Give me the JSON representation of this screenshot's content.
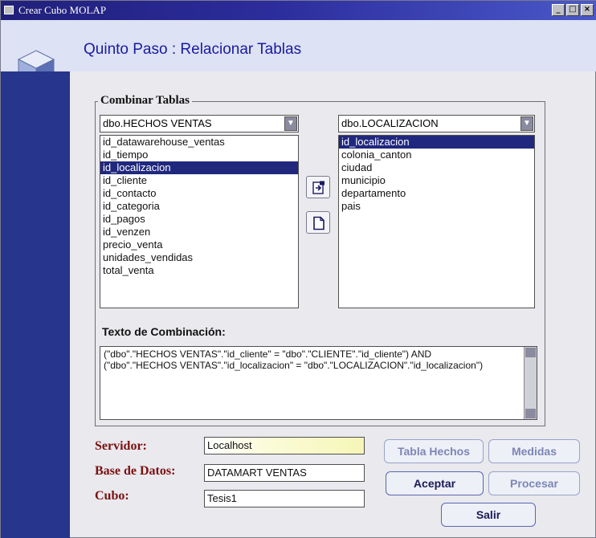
{
  "window": {
    "title": "Crear Cubo MOLAP",
    "controls": [
      "_",
      "□",
      "×"
    ]
  },
  "header": {
    "title": "Quinto Paso : Relacionar Tablas",
    "icon": "cube-icon"
  },
  "combine": {
    "legend": "Combinar Tablas",
    "left_table": "dbo.HECHOS VENTAS",
    "right_table": "dbo.LOCALIZACION",
    "left_columns": [
      "id_datawarehouse_ventas",
      "id_tiempo",
      "id_localizacion",
      "id_cliente",
      "id_contacto",
      "id_categoria",
      "id_pagos",
      "id_venzen",
      "precio_venta",
      "unidades_vendidas",
      "total_venta"
    ],
    "left_selected_index": 2,
    "right_columns": [
      "id_localizacion",
      "colonia_canton",
      "ciudad",
      "municipio",
      "departamento",
      "pais"
    ],
    "right_selected_index": 0,
    "add_icon": "add-relation-icon",
    "clear_icon": "new-document-icon"
  },
  "combination_text": {
    "label": "Texto de Combinación:",
    "line1": "(\"dbo\".\"HECHOS VENTAS\".\"id_cliente\" = \"dbo\".\"CLIENTE\".\"id_cliente\") AND",
    "line2": "(\"dbo\".\"HECHOS VENTAS\".\"id_localizacion\" = \"dbo\".\"LOCALIZACION\".\"id_localizacion\")"
  },
  "form": {
    "server_label": "Servidor:",
    "server_value": "Localhost",
    "db_label": "Base de Datos:",
    "db_value": "DATAMART VENTAS",
    "cube_label": "Cubo:",
    "cube_value": "Tesis1"
  },
  "buttons": {
    "fact_table": "Tabla Hechos",
    "measures": "Medidas",
    "accept": "Aceptar",
    "process": "Procesar",
    "exit": "Salir"
  },
  "colors": {
    "title_bar": "#20207a",
    "header_bg": "#dde2f4",
    "left_strip": "#27358c",
    "selection": "#20287e",
    "field_label": "#7a1010"
  }
}
